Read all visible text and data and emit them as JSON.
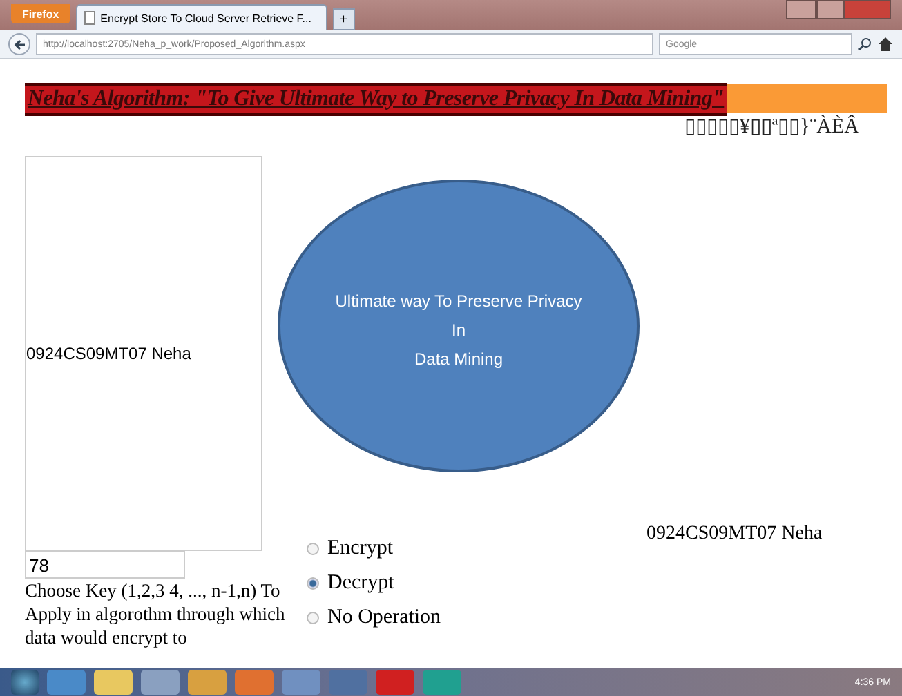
{
  "browser": {
    "menu_button": "Firefox",
    "tabs": [
      {
        "label": "Encrypt Store To Cloud Server Retrieve F...",
        "selected": true
      }
    ],
    "new_tab": "+",
    "url": "http://localhost:2705/Neha_p_work/Proposed_Algorithm.aspx",
    "search_placeholder": "Google"
  },
  "page": {
    "heading": "Neha's Algorithm: \"To Give Ultimate Way to Preserve Privacy In Data Mining\"",
    "garbled_text": "▯▯▯▯▯¥▯▯ª▯▯}¨ÀÈÂ",
    "left_box_text": "0924CS09MT07 Neha",
    "diagram_lines": [
      "Ultimate way To Preserve Privacy",
      "In",
      "Data Mining"
    ],
    "right_text": "0924CS09MT07 Neha",
    "key_value": "78",
    "key_help": "Choose Key (1,2,3 4, ..., n-1,n) To Apply in algorothm through which data would encrypt to",
    "operations": [
      {
        "label": "Encrypt",
        "selected": false
      },
      {
        "label": "Decrypt",
        "selected": true
      },
      {
        "label": "No Operation",
        "selected": false
      }
    ]
  },
  "taskbar": {
    "time": "4:36 PM"
  }
}
